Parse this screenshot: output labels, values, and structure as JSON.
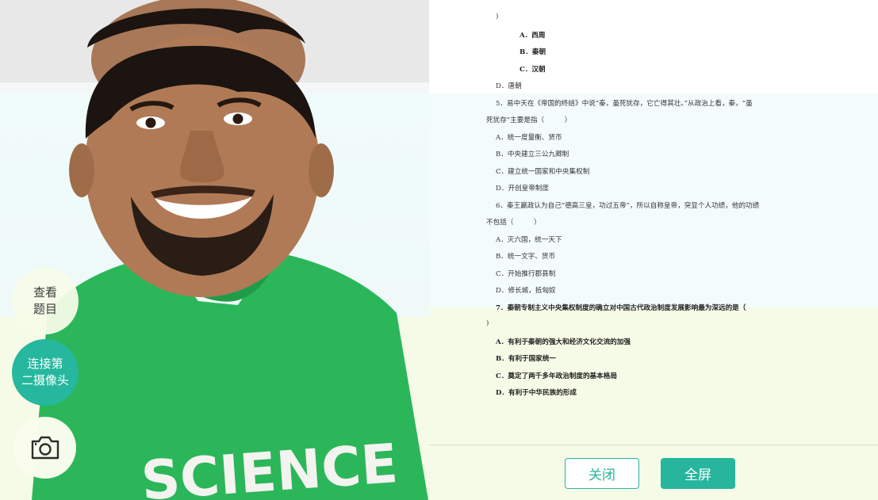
{
  "side_controls": {
    "view_questions": "查看\n题目",
    "connect_second_camera": "连接第\n二摄像头",
    "camera_icon": "camera-switch-icon"
  },
  "photo": {
    "shirt_text": "SCIENCE",
    "shirt_color": "#1fa84a",
    "background_tint": "#eef9f8"
  },
  "exam": {
    "lines": [
      {
        "text": ")",
        "indent": 1,
        "bold": false
      },
      {
        "text": "A．西周",
        "indent": 2,
        "bold": true
      },
      {
        "text": "B．秦朝",
        "indent": 2,
        "bold": true
      },
      {
        "text": "C．汉朝",
        "indent": 2,
        "bold": true
      },
      {
        "text": "D．唐朝",
        "indent": 1,
        "bold": false
      },
      {
        "text": "5．易中天在《帝国的终结》中说“秦，虽死犹存，它亡得其壮。”从政治上看，秦，“虽",
        "indent": 1,
        "bold": false
      },
      {
        "text": "死犹存”主要是指（　　　）",
        "indent": 0,
        "bold": false
      },
      {
        "text": "A．统一度量衡、货币",
        "indent": 1,
        "bold": false
      },
      {
        "text": "B．中央建立三公九卿制",
        "indent": 1,
        "bold": false
      },
      {
        "text": "C．建立统一国家和中央集权制",
        "indent": 1,
        "bold": false
      },
      {
        "text": "D．开创皇帝制度",
        "indent": 1,
        "bold": false
      },
      {
        "text": "6．秦王嬴政认为自己“德高三皇，功过五帝”，所以自称皇帝，突显个人功绩，他的功绩",
        "indent": 1,
        "bold": false
      },
      {
        "text": "不包括（　　　）",
        "indent": 0,
        "bold": false
      },
      {
        "text": "A．灭六国，统一天下",
        "indent": 1,
        "bold": false
      },
      {
        "text": "B．统一文字、货币",
        "indent": 1,
        "bold": false
      },
      {
        "text": "C．开始推行郡县制",
        "indent": 1,
        "bold": false
      },
      {
        "text": "D．修长城，抵匈奴",
        "indent": 1,
        "bold": false
      },
      {
        "text": "7．秦朝专制主义中央集权制度的确立对中国古代政治制度发展影响最为深远的是（",
        "indent": 1,
        "bold": true
      },
      {
        "text": ")",
        "indent": 0,
        "bold": false
      },
      {
        "text": "A．有利于秦朝的强大和经济文化交流的加强",
        "indent": 1,
        "bold": true
      },
      {
        "text": "B．有利于国家统一",
        "indent": 1,
        "bold": true
      },
      {
        "text": "C．奠定了两千多年政治制度的基本格局",
        "indent": 1,
        "bold": true
      },
      {
        "text": "D．有利于中华民族的形成",
        "indent": 1,
        "bold": true
      }
    ]
  },
  "footer": {
    "close_label": "关闭",
    "fullscreen_label": "全屏"
  },
  "colors": {
    "accent": "#27b59d",
    "second_cam_button": "#26b79f"
  }
}
